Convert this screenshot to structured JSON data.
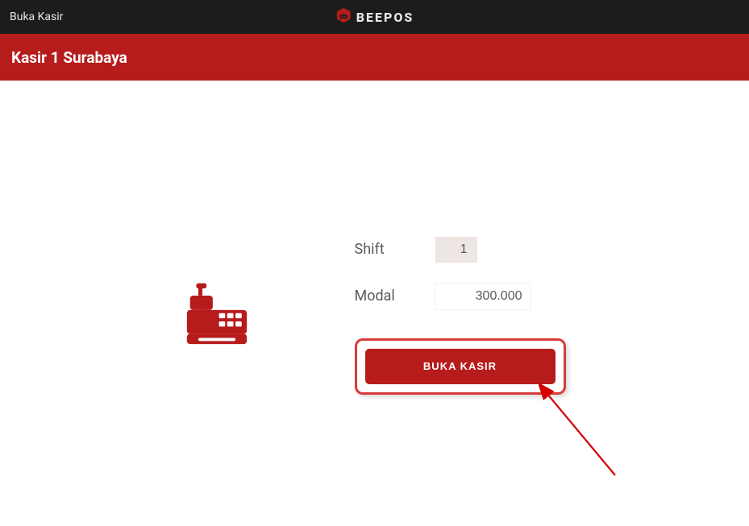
{
  "topbar": {
    "title": "Buka Kasir",
    "brand": "BEEPOS"
  },
  "header": {
    "title": "Kasir 1 Surabaya"
  },
  "form": {
    "shift_label": "Shift",
    "shift_value": "1",
    "modal_label": "Modal",
    "modal_value": "300.000",
    "button_label": "BUKA KASIR"
  },
  "colors": {
    "primary": "#b71c1c",
    "dark": "#1c1c1c"
  }
}
